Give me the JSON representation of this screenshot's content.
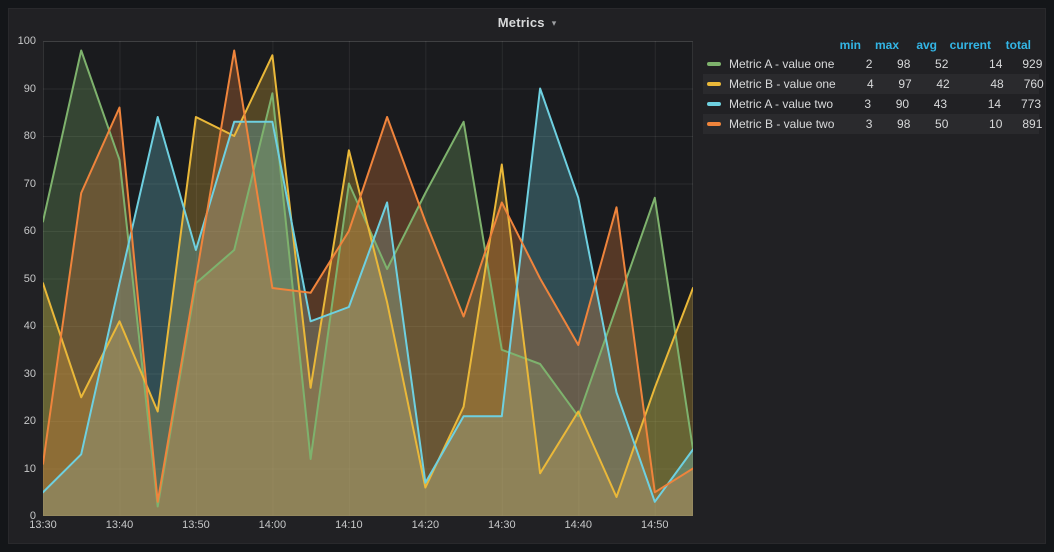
{
  "panel": {
    "title": "Metrics",
    "dropdown_caret": "▾"
  },
  "colors": {
    "page_bg": "#141619",
    "panel_bg": "#212124",
    "plot_bg": "#1a1b1e",
    "grid": "rgba(255,255,255,0.07)",
    "axis_text": "#c7c8c9",
    "legend_header": "#33b5e5"
  },
  "legend": {
    "columns": [
      "min",
      "max",
      "avg",
      "current",
      "total"
    ]
  },
  "chart_data": {
    "type": "line",
    "x": [
      "13:30",
      "13:35",
      "13:40",
      "13:45",
      "13:50",
      "13:55",
      "14:00",
      "14:05",
      "14:10",
      "14:15",
      "14:20",
      "14:25",
      "14:30",
      "14:35",
      "14:40",
      "14:45",
      "14:50",
      "14:55"
    ],
    "x_axis_ticks": [
      "13:30",
      "13:40",
      "13:50",
      "14:00",
      "14:10",
      "14:20",
      "14:30",
      "14:40",
      "14:50"
    ],
    "y_ticks": [
      0,
      10,
      20,
      30,
      40,
      50,
      60,
      70,
      80,
      90,
      100
    ],
    "ylim": [
      0,
      100
    ],
    "grid": true,
    "legend_position": "right-table",
    "fill_opacity": 0.28,
    "series": [
      {
        "name": "Metric A - value one",
        "color": "#7EB26D",
        "values": [
          62,
          98,
          75,
          2,
          49,
          56,
          89,
          12,
          70,
          52,
          68,
          83,
          35,
          32,
          21,
          44,
          67,
          14
        ],
        "stats": {
          "min": 2,
          "max": 98,
          "avg": 52,
          "current": 14,
          "total": 929
        }
      },
      {
        "name": "Metric B - value one",
        "color": "#EAB839",
        "values": [
          49,
          25,
          41,
          22,
          84,
          80,
          97,
          27,
          77,
          45,
          6,
          23,
          74,
          9,
          22,
          4,
          27,
          48
        ],
        "stats": {
          "min": 4,
          "max": 97,
          "avg": 42,
          "current": 48,
          "total": 760
        }
      },
      {
        "name": "Metric A - value two",
        "color": "#6ED0E0",
        "values": [
          5,
          13,
          49,
          84,
          56,
          83,
          83,
          41,
          44,
          66,
          7,
          21,
          21,
          90,
          67,
          26,
          3,
          14
        ],
        "stats": {
          "min": 3,
          "max": 90,
          "avg": 43,
          "current": 14,
          "total": 773
        }
      },
      {
        "name": "Metric B - value two",
        "color": "#EF843C",
        "values": [
          11,
          68,
          86,
          3,
          50,
          98,
          48,
          47,
          60,
          84,
          62,
          42,
          66,
          50,
          36,
          65,
          5,
          10
        ],
        "stats": {
          "min": 3,
          "max": 98,
          "avg": 50,
          "current": 10,
          "total": 891
        }
      }
    ]
  }
}
